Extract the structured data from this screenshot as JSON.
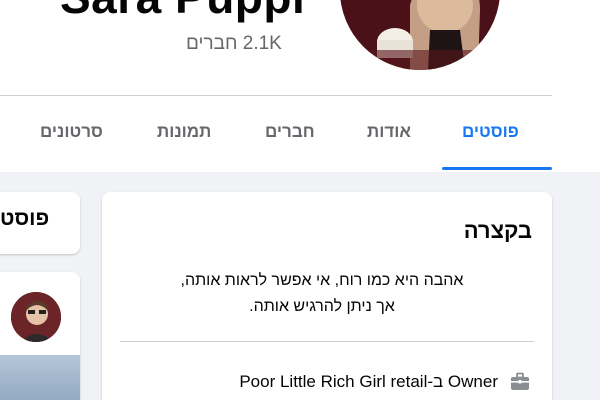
{
  "profile": {
    "name": "Sara Puppi",
    "friends": "2.1K חברים"
  },
  "tabs": [
    {
      "label": "פוסטים",
      "active": true
    },
    {
      "label": "אודות",
      "active": false
    },
    {
      "label": "חברים",
      "active": false
    },
    {
      "label": "תמונות",
      "active": false
    },
    {
      "label": "סרטונים",
      "active": false
    }
  ],
  "posts_section": {
    "title": "פוסט"
  },
  "intro": {
    "title": "בקצרה",
    "bio_line1": "אהבה היא כמו רוח, אי אפשר לראות אותה,",
    "bio_line2": "אך ניתן להרגיש אותה.",
    "work": "Owner ב-Poor Little Rich Girl retail",
    "work_icon": "briefcase-icon"
  },
  "colors": {
    "accent": "#1877f2",
    "muted_text": "#65676b",
    "background": "#f0f2f5"
  }
}
